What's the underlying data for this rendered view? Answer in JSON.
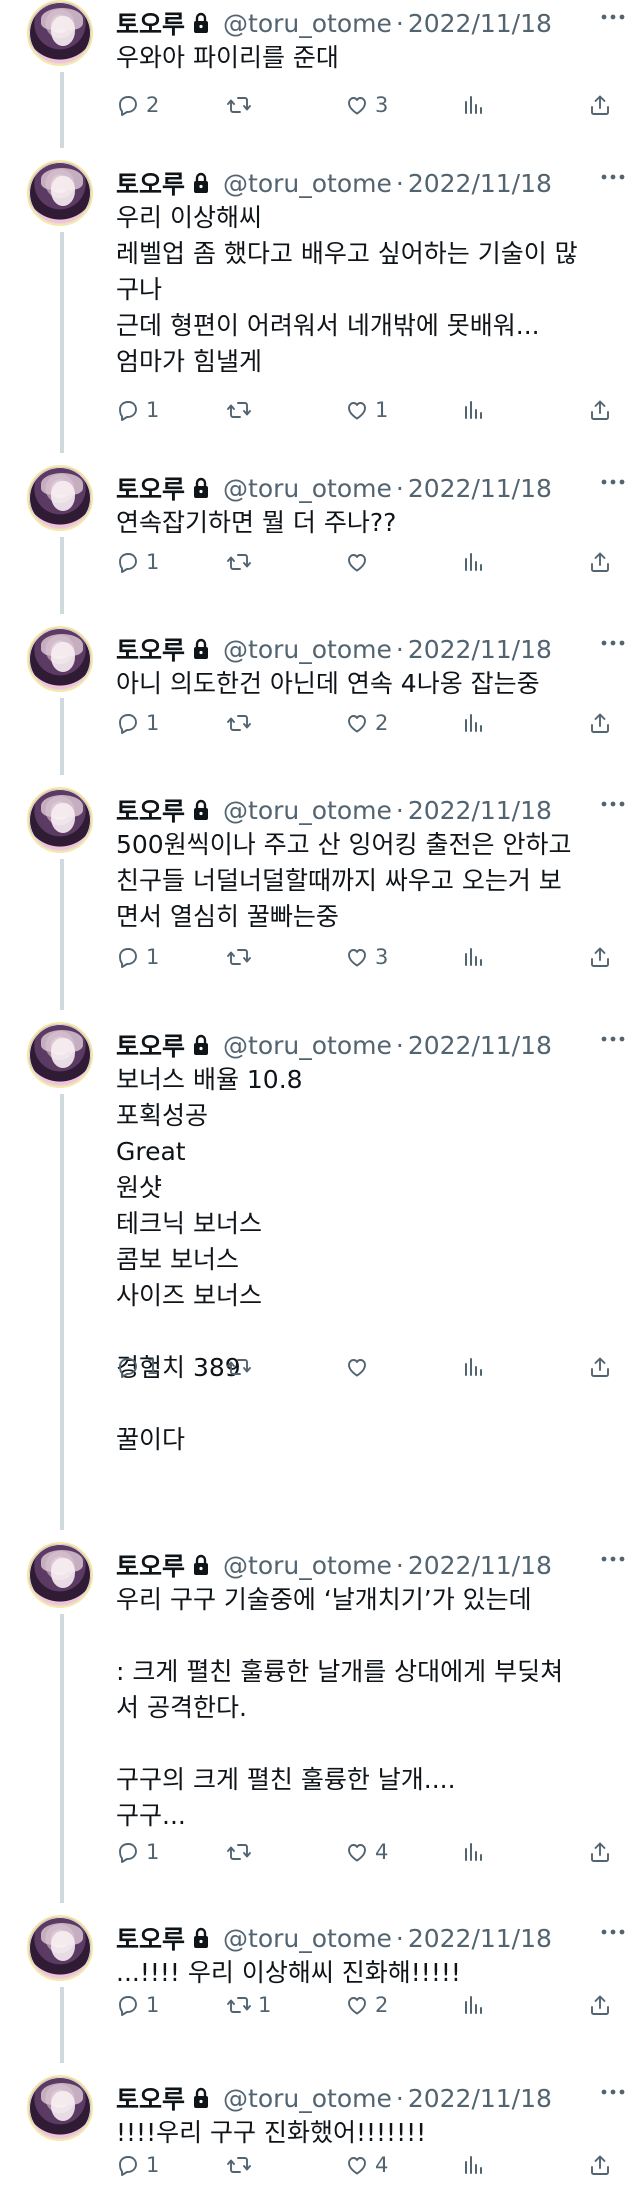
{
  "colors": {
    "text": "#0f1419",
    "secondary": "#536471",
    "thread_line": "#cfd9de",
    "background": "#ffffff"
  },
  "icons": {
    "reply": "comment-bubble-icon",
    "retweet": "retweet-arrows-icon",
    "like": "heart-icon",
    "views": "bar-chart-icon",
    "share": "share-upload-icon",
    "more": "more-dots-icon",
    "lock": "lock-icon"
  },
  "tweets": [
    {
      "name": "토오루",
      "handle": "@toru_otome",
      "separator": "·",
      "date": "2022/11/18",
      "text": "우와아 파이리를 준대",
      "replies": "2",
      "retweets": "",
      "likes": "3"
    },
    {
      "name": "토오루",
      "handle": "@toru_otome",
      "separator": "·",
      "date": "2022/11/18",
      "text": "우리 이상해씨\n레벨업 좀 했다고 배우고 싶어하는 기술이 많\n구나\n근데 형편이 어려워서 네개밖에 못배워...\n엄마가 힘낼게",
      "replies": "1",
      "retweets": "",
      "likes": "1"
    },
    {
      "name": "토오루",
      "handle": "@toru_otome",
      "separator": "·",
      "date": "2022/11/18",
      "text": "연속잡기하면 뭘 더 주나??",
      "replies": "1",
      "retweets": "",
      "likes": ""
    },
    {
      "name": "토오루",
      "handle": "@toru_otome",
      "separator": "·",
      "date": "2022/11/18",
      "text": "아니 의도한건 아닌데 연속 4나옹 잡는중",
      "replies": "1",
      "retweets": "",
      "likes": "2"
    },
    {
      "name": "토오루",
      "handle": "@toru_otome",
      "separator": "·",
      "date": "2022/11/18",
      "text": "500원씩이나 주고 산 잉어킹 출전은 안하고\n친구들 너덜너덜할때까지 싸우고 오는거 보\n면서 열심히 꿀빠는중",
      "replies": "1",
      "retweets": "",
      "likes": "3"
    },
    {
      "name": "토오루",
      "handle": "@toru_otome",
      "separator": "·",
      "date": "2022/11/18",
      "text": "보너스 배율 10.8\n포획성공\nGreat\n원샷\n테크닉 보너스\n콤보 보너스\n사이즈 보너스\n\n경험치 389\n\n꿀이다",
      "replies": "1",
      "retweets": "",
      "likes": ""
    },
    {
      "name": "토오루",
      "handle": "@toru_otome",
      "separator": "·",
      "date": "2022/11/18",
      "text": "우리 구구 기술중에 ‘날개치기’가 있는데\n\n: 크게 펼친 훌륭한 날개를 상대에게 부딪쳐\n서 공격한다.\n\n구구의 크게 펼친 훌륭한 날개....\n구구...",
      "replies": "1",
      "retweets": "",
      "likes": "4"
    },
    {
      "name": "토오루",
      "handle": "@toru_otome",
      "separator": "·",
      "date": "2022/11/18",
      "text": "...!!!! 우리 이상해씨 진화해!!!!!",
      "replies": "1",
      "retweets": "1",
      "likes": "2"
    },
    {
      "name": "토오루",
      "handle": "@toru_otome",
      "separator": "·",
      "date": "2022/11/18",
      "text": "!!!!우리 구구 진화했어!!!!!!!",
      "replies": "1",
      "retweets": "",
      "likes": "4"
    }
  ]
}
